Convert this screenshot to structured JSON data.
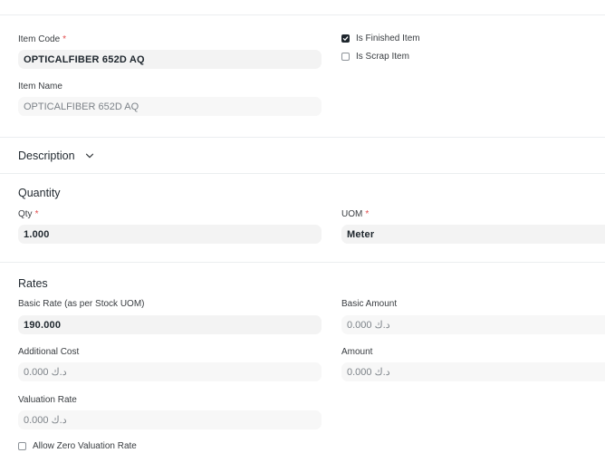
{
  "item": {
    "code_label": "Item Code",
    "code_value": "OPTICALFIBER 652D AQ",
    "name_label": "Item Name",
    "name_value": "OPTICALFIBER 652D AQ",
    "is_finished_label": "Is Finished Item",
    "is_finished_checked": true,
    "is_scrap_label": "Is Scrap Item",
    "is_scrap_checked": false
  },
  "description": {
    "title": "Description",
    "icon": "chevron-down-icon"
  },
  "quantity": {
    "title": "Quantity",
    "qty_label": "Qty",
    "qty_value": "1.000",
    "uom_label": "UOM",
    "uom_value": "Meter"
  },
  "rates": {
    "title": "Rates",
    "basic_rate_label": "Basic Rate (as per Stock UOM)",
    "basic_rate_value": "190.000",
    "basic_amount_label": "Basic Amount",
    "basic_amount_value": "0.000 د.ك",
    "additional_cost_label": "Additional Cost",
    "additional_cost_value": "0.000 د.ك",
    "amount_label": "Amount",
    "amount_value": "0.000 د.ك",
    "valuation_rate_label": "Valuation Rate",
    "valuation_rate_value": "0.000 د.ك",
    "allow_zero_label": "Allow Zero Valuation Rate",
    "allow_zero_checked": false
  },
  "required_marker": "*",
  "colors": {
    "required": "#e24c4c",
    "field_bg": "#f3f3f3",
    "text": "#1f272e",
    "muted": "#7c8288"
  }
}
